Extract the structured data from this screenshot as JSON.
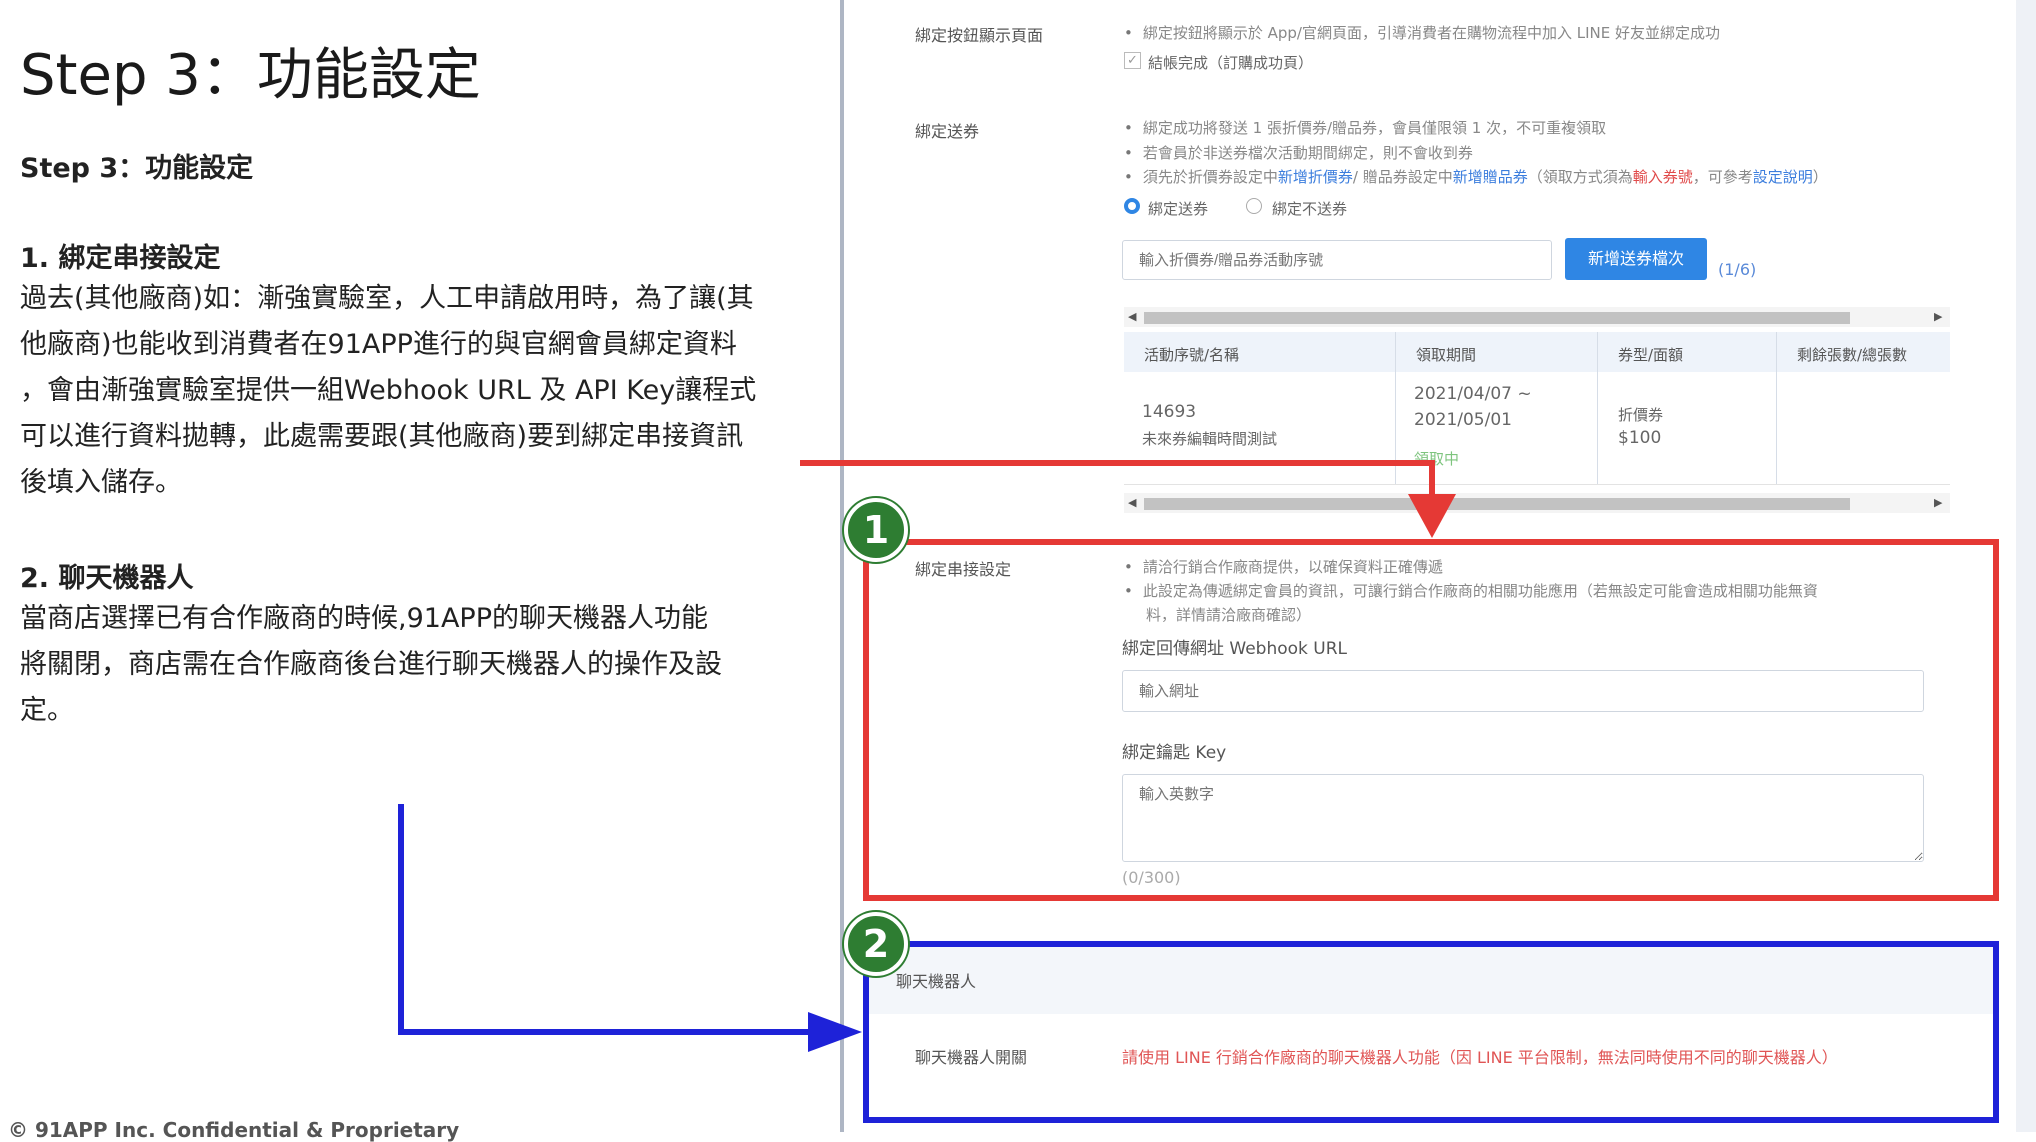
{
  "slide": {
    "title": "Step 3：功能設定",
    "subtitle": "Step 3：功能設定",
    "section1": {
      "heading": "1. 綁定串接設定",
      "lines": [
        "過去(其他廠商)如：漸強實驗室，人工申請啟用時，為了讓(其",
        "他廠商)也能收到消費者在91APP進行的與官網會員綁定資料",
        "，會由漸強實驗室提供一組Webhook URL 及 API Key讓程式",
        "可以進行資料拋轉，此處需要跟(其他廠商)要到綁定串接資訊",
        "後填入儲存。"
      ]
    },
    "section2": {
      "heading": "2. 聊天機器人",
      "lines": [
        "當商店選擇已有合作廠商的時候,91APP的聊天機器人功能",
        "將關閉，商店需在合作廠商後台進行聊天機器人的操作及設",
        "定。"
      ]
    },
    "footer": "© 91APP Inc. Confidential & Proprietary"
  },
  "panel": {
    "bind_page": {
      "label": "綁定按鈕顯示頁面",
      "bullet": "綁定按鈕將顯示於 App/官網頁面，引導消費者在購物流程中加入 LINE 好友並綁定成功",
      "checkbox_label": "結帳完成（訂購成功頁）",
      "checkbox_mark": "✓"
    },
    "bind_coupon": {
      "label": "綁定送券",
      "bullet1": "綁定成功將發送 1 張折價券/贈品券，會員僅限領 1 次，不可重複領取",
      "bullet2": "若會員於非送券檔次活動期間綁定，則不會收到券",
      "bullet3_pre": "須先於折價券設定中",
      "bullet3_link1": "新增折價券",
      "bullet3_mid": "/ 贈品券設定中",
      "bullet3_link2": "新增贈品券",
      "bullet3_mid2": "（領取方式須為",
      "bullet3_red": "輸入券號",
      "bullet3_mid3": "，可參考",
      "bullet3_link3": "設定說明",
      "bullet3_end": "）",
      "radio_on": "綁定送券",
      "radio_off": "綁定不送券",
      "input_placeholder": "輸入折價券/贈品券活動序號",
      "add_button": "新增送券檔次",
      "count": "(1/6)"
    },
    "table": {
      "headers": [
        "活動序號/名稱",
        "領取期間",
        "券型/面額",
        "剩餘張數/總張數"
      ],
      "row": {
        "id": "14693",
        "name": "未來券編輯時間測試",
        "period_start": "2021/04/07 ~",
        "period_end": "2021/05/01",
        "status": "領取中",
        "type": "折價券",
        "amount": "$100"
      }
    },
    "integration": {
      "label": "綁定串接設定",
      "bullet1": "請洽行銷合作廠商提供，以確保資料正確傳遞",
      "bullet2a": "此設定為傳遞綁定會員的資訊，可讓行銷合作廠商的相關功能應用（若無設定可能會造成相關功能無資",
      "bullet2b": "料，詳情請洽廠商確認）",
      "webhook_label": "綁定回傳網址 Webhook URL",
      "webhook_placeholder": "輸入網址",
      "key_label": "綁定鑰匙 Key",
      "key_placeholder": "輸入英數字",
      "key_counter": "(0/300)"
    },
    "chatbot": {
      "title": "聊天機器人",
      "label": "聊天機器人開關",
      "note": "請使用 LINE 行銷合作廠商的聊天機器人功能（因 LINE 平台限制，無法同時使用不同的聊天機器人）"
    },
    "badges": [
      "1",
      "2"
    ]
  },
  "colors": {
    "highlight_red": "#e53935",
    "highlight_blue": "#1e22d8",
    "badge_green": "#2e7d32",
    "button_blue": "#2f86e4"
  }
}
